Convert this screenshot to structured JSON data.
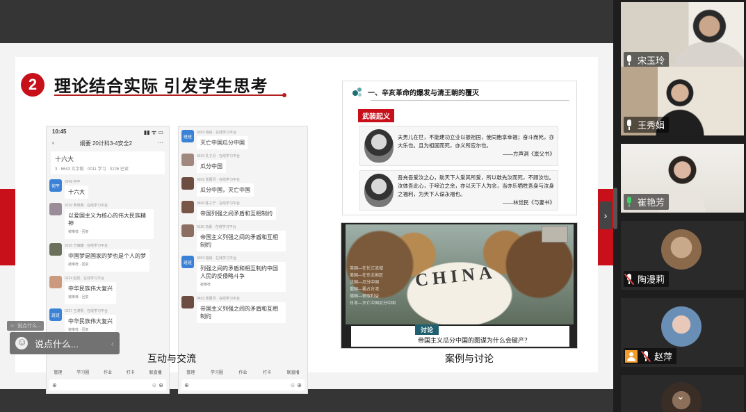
{
  "slide": {
    "number": "2",
    "title": "理论结合实际 引发学生思考",
    "caption_left": "互动与交流",
    "caption_right": "案例与讨论"
  },
  "phone1": {
    "time": "10:45",
    "signal": "▮▮ ᯤ ▭",
    "title": "纲要 20计科3-4安全2",
    "pinned": "十六大",
    "pinned_meta": "3 · 6643 文字版 · 0011 学习 · 0226 已读",
    "messages": [
      {
        "avatar": "何平",
        "meta": "0248 何平",
        "text": "十六大",
        "tag": ""
      },
      {
        "avatar": "",
        "meta": "0210 朱晓英 · 在线学习平台",
        "text": "以爱国主义为核心的伟大民族精神",
        "tag": "被推荐 · 回复"
      },
      {
        "avatar": "",
        "meta": "0210 方瑞婕 · 在线学习平台",
        "text": "中国梦是国家的梦也是个人的梦",
        "tag": "被推荐 · 回复"
      },
      {
        "avatar": "",
        "meta": "0224 赵凯 · 在线学习平台",
        "text": "中华民族伟大复兴",
        "tag": "被推荐 · 回复"
      },
      {
        "avatar": "班班",
        "meta": "0227 王涛凯 · 在线学习平台",
        "text": "中华民族伟大复兴",
        "tag": "被推荐 · 回复"
      }
    ],
    "tabs": [
      "管理",
      "学习圈",
      "作业",
      "打卡",
      "联直播"
    ]
  },
  "phone2": {
    "messages": [
      {
        "avatar": "班班",
        "meta": "0203 班级 · 在线学习平台",
        "text": "灭亡中国瓜分中国",
        "tag": ""
      },
      {
        "avatar": "",
        "meta": "0210 孔子月 · 在线学习平台",
        "text": "瓜分中国",
        "tag": ""
      },
      {
        "avatar": "",
        "meta": "0202 张蕾月 · 在线学习平台",
        "text": "瓜分中国，灭亡中国",
        "tag": ""
      },
      {
        "avatar": "",
        "meta": "0406 陈子宁 · 在线学习平台",
        "text": "帝国列强之间矛盾和互相制约",
        "tag": ""
      },
      {
        "avatar": "",
        "meta": "0116 马斯 · 在线学习平台",
        "text": "帝国主义列强之间的矛盾和互相制约",
        "tag": ""
      },
      {
        "avatar": "班班",
        "meta": "0203 班级 · 在线学习平台",
        "text": "列强之间的矛盾和相互制约中国人民的反侵略斗争",
        "tag": "被推荐"
      },
      {
        "avatar": "",
        "meta": "0432 张蕾月 · 在线学习平台",
        "text": "帝国主义列强之间的矛盾和互相制约",
        "tag": ""
      }
    ],
    "tabs": [
      "管理",
      "学习圈",
      "作业",
      "打卡",
      "联直播"
    ]
  },
  "card_revolution": {
    "title": "一、辛亥革命的爆发与清王朝的覆灭",
    "tag": "武装起义",
    "quote1": "夫男儿在世，不能建功立业以振祖国，使同胞享幸福；奋斗而死，亦大乐也。且为祖国而死，亦义所应尔也。",
    "quote1_src": "——方声洞《禀父书》",
    "quote2": "吾充吾爱汝之心，助天下人爱其所爱，所以敢先汝而死，不顾汝也。汝体吾此心，于啼泣之余，亦以天下人为念，当亦乐牺牲吾身与汝身之福利，为天下人谋永福也。",
    "quote2_src": "——林觉民《与妻书》"
  },
  "card_cartoon": {
    "word": "CHINA",
    "labels": [
      "英国—",
      "美国—",
      "法国—",
      "俄国—",
      "德国—",
      "日本—"
    ],
    "label_right": [
      "在长江流域",
      "在东北地区",
      "瓜分中国",
      "霸占台湾",
      "获取利益",
      "灭亡中国瓜分中国"
    ],
    "discuss_tag": "讨论",
    "question": "帝国主义瓜分中国的图谋为什么会破产？"
  },
  "chat": {
    "hint": "说点什么...",
    "placeholder": "说点什么..."
  },
  "participants": [
    {
      "name": "宋玉玲",
      "mic": "on"
    },
    {
      "name": "王秀娟",
      "mic": "on"
    },
    {
      "name": "崔艳芳",
      "mic": "speaking"
    },
    {
      "name": "陶漫莉",
      "mic": "muted"
    },
    {
      "name": "赵萍",
      "mic": "muted"
    }
  ],
  "colors": {
    "accent_red": "#c7101a",
    "speaking_green": "#3fbf6a",
    "teal": "#1f5f6f"
  }
}
